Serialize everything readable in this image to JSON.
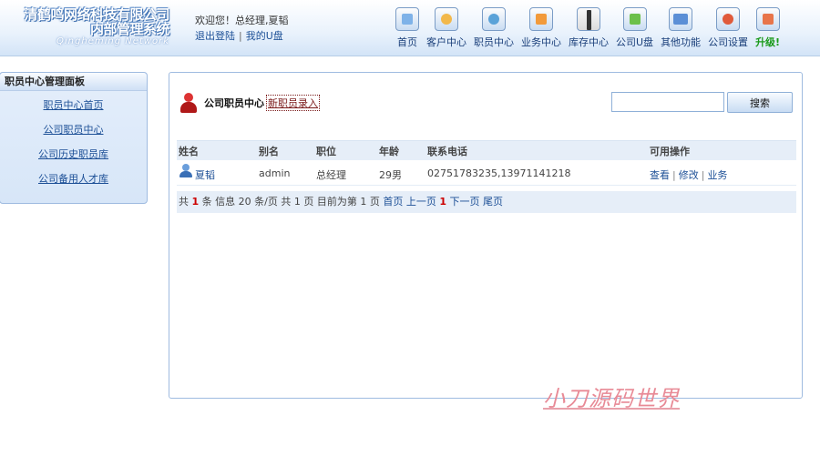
{
  "header": {
    "company_line1": "清鹤鸣网络科技有限公司",
    "company_line2": "内部管理系统",
    "company_english": "Qingheming Network",
    "welcome_text": "欢迎您！总经理,夏韬",
    "logout_label": "退出登陆",
    "separator": "|",
    "my_udisk_label": "我的U盘",
    "nav": [
      {
        "label": "首页",
        "icon": "home-icon"
      },
      {
        "label": "客户中心",
        "icon": "customer-icon"
      },
      {
        "label": "职员中心",
        "icon": "staff-icon"
      },
      {
        "label": "业务中心",
        "icon": "business-icon"
      },
      {
        "label": "库存中心",
        "icon": "stock-icon"
      },
      {
        "label": "公司U盘",
        "icon": "udisk-icon"
      },
      {
        "label": "其他功能",
        "icon": "other-functions-icon"
      },
      {
        "label": "公司设置",
        "icon": "settings-icon"
      },
      {
        "label": "升级!",
        "icon": "upgrade-icon"
      }
    ]
  },
  "sidebar": {
    "title": "职员中心管理面板",
    "items": [
      {
        "label": "职员中心首页"
      },
      {
        "label": "公司职员中心"
      },
      {
        "label": "公司历史职员库"
      },
      {
        "label": "公司备用人才库"
      }
    ]
  },
  "main": {
    "title": "公司职员中心",
    "new_entry_label": "新职员录入",
    "search": {
      "value": "",
      "button_label": "搜索"
    },
    "table": {
      "columns": [
        "姓名",
        "别名",
        "职位",
        "年龄",
        "联系电话",
        "可用操作"
      ],
      "rows": [
        {
          "name": "夏韬",
          "alias": "admin",
          "position": "总经理",
          "age": "29男",
          "phone": "02751783235,13971141218",
          "ops": [
            "查看",
            "修改",
            "业务"
          ]
        }
      ]
    },
    "pager": {
      "total_prefix": "共",
      "total_count": "1",
      "total_suffix": "条 信息 20 条/页 共 1 页 目前为第 1 页",
      "first": "首页",
      "prev": "上一页",
      "current": "1",
      "next": "下一页",
      "last": "尾页"
    }
  },
  "watermark": "小刀源码世界"
}
